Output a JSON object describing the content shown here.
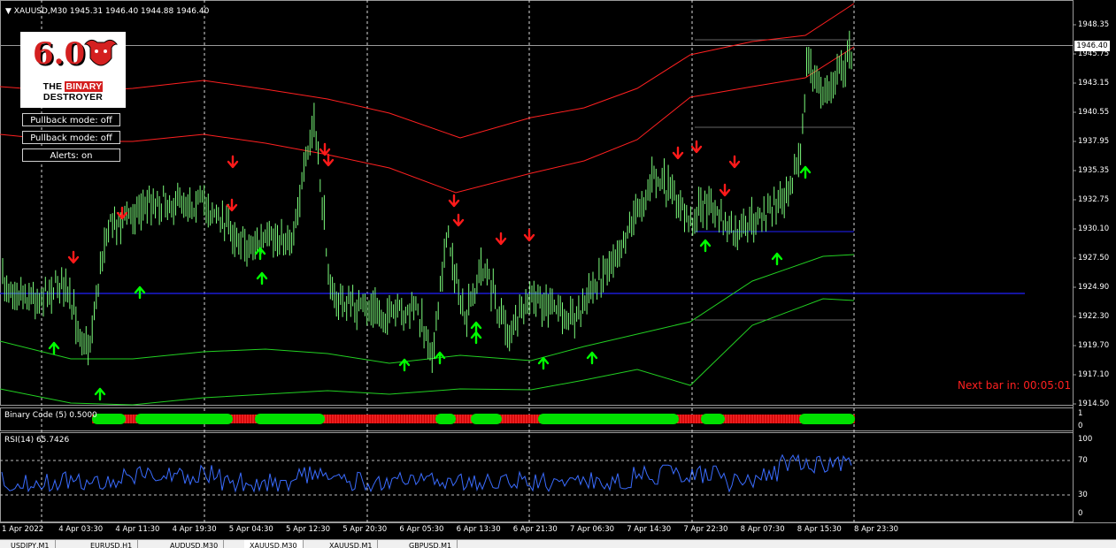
{
  "symbol_header": "XAUUSD,M30  1945.31 1946.40 1944.88 1946.40",
  "price_axis": [
    "1948.35",
    "1945.75",
    "1943.15",
    "1940.55",
    "1937.95",
    "1935.35",
    "1932.75",
    "1930.10",
    "1927.50",
    "1924.90",
    "1922.30",
    "1919.70",
    "1917.10",
    "1914.50"
  ],
  "current_price": "1946.40",
  "time_axis": [
    "1 Apr 2022",
    "4 Apr 03:30",
    "4 Apr 11:30",
    "4 Apr 19:30",
    "5 Apr 04:30",
    "5 Apr 12:30",
    "5 Apr 20:30",
    "6 Apr 05:30",
    "6 Apr 13:30",
    "6 Apr 21:30",
    "7 Apr 06:30",
    "7 Apr 14:30",
    "7 Apr 22:30",
    "8 Apr 07:30",
    "8 Apr 15:30",
    "8 Apr 23:30"
  ],
  "logo": {
    "version": "6.0",
    "title_a": "THE ",
    "title_b": "BINARY",
    "title_c": " DESTROYER"
  },
  "buttons": {
    "pullback_1": "Pullback mode: off",
    "pullback_2": "Pullback mode: off",
    "alerts": "Alerts: on"
  },
  "next_bar": "Next bar in: 00:05:01",
  "indicator1": {
    "label": "Binary Code (5) 0.5000",
    "axis_top": "1",
    "axis_bottom": "0"
  },
  "indicator2": {
    "label": "RSI(14) 65.7426",
    "levels": [
      "100",
      "70",
      "30",
      "0"
    ]
  },
  "tabs": [
    "USDJPY,M1",
    "EURUSD,H1",
    "AUDUSD,M30",
    "XAUUSD,M30",
    "XAUUSD,M1",
    "GBPUSD,M1"
  ],
  "colors": {
    "candle": "#7CFC7C",
    "upper_band": "#ff2020",
    "lower_band": "#22d022",
    "buy_arrow": "#00ff00",
    "sell_arrow": "#ff1a1a",
    "rsi": "#3a6cff",
    "level_line": "#2020ff"
  }
}
